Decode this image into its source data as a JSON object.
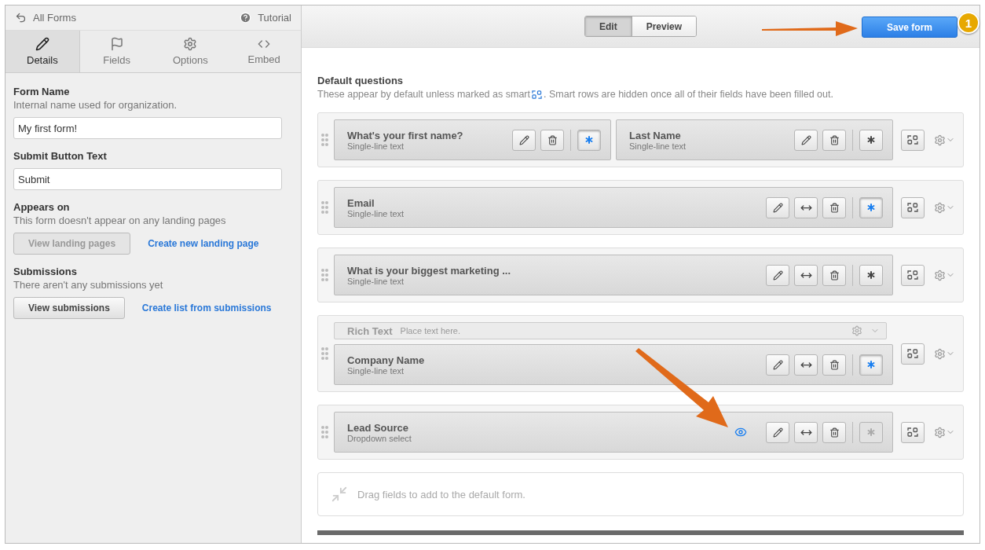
{
  "sidebar": {
    "back_link": "All Forms",
    "help_link": "Tutorial",
    "tabs": [
      {
        "label": "Details",
        "selected": true
      },
      {
        "label": "Fields",
        "selected": false
      },
      {
        "label": "Options",
        "selected": false
      },
      {
        "label": "Embed",
        "selected": false
      }
    ],
    "sections": [
      {
        "kind": "input",
        "title": "Form Name",
        "hint": "Internal name used for organization.",
        "value": "My first form!"
      },
      {
        "kind": "input",
        "title": "Submit Button Text",
        "value": "Submit"
      },
      {
        "kind": "actions",
        "title": "Appears on",
        "hint": "This form doesn't appear on any landing pages",
        "button": {
          "label": "View landing pages",
          "disabled": true
        },
        "link": "Create new landing page"
      },
      {
        "kind": "actions",
        "title": "Submissions",
        "hint": "There aren't any submissions yet",
        "button": {
          "label": "View submissions",
          "disabled": false
        },
        "link": "Create list from submissions"
      }
    ]
  },
  "toolbar": {
    "modes": [
      {
        "label": "Edit",
        "selected": true
      },
      {
        "label": "Preview",
        "selected": false
      }
    ],
    "save_button": "Save form",
    "badge": "1"
  },
  "questions": {
    "title": "Default questions",
    "description_before": "These appear by default unless marked as smart",
    "description_after": ". Smart rows are hidden once all of their fields have been filled out.",
    "rows": [
      {
        "fields": [
          {
            "label": "What's your first name?",
            "type": "Single-line text",
            "width_button": false,
            "visible_icon": false,
            "required": true,
            "required_disabled": false
          },
          {
            "label": "Last Name",
            "type": "Single-line text",
            "width_button": false,
            "visible_icon": false,
            "required": false,
            "required_disabled": false
          }
        ]
      },
      {
        "fields": [
          {
            "label": "Email",
            "type": "Single-line text",
            "width_button": true,
            "visible_icon": false,
            "required": true,
            "required_disabled": false
          }
        ]
      },
      {
        "fields": [
          {
            "label": "What is your biggest marketing ...",
            "type": "Single-line text",
            "width_button": true,
            "visible_icon": false,
            "required": false,
            "required_disabled": false
          }
        ]
      },
      {
        "rich_text": {
          "label": "Rich Text",
          "placeholder": "Place text here."
        },
        "fields": [
          {
            "label": "Company Name",
            "type": "Single-line text",
            "width_button": true,
            "visible_icon": false,
            "required": true,
            "required_disabled": false
          }
        ]
      },
      {
        "fields": [
          {
            "label": "Lead Source",
            "type": "Dropdown select",
            "width_button": true,
            "visible_icon": true,
            "required": false,
            "required_disabled": true
          }
        ]
      }
    ],
    "drop_zone": "Drag fields to add to the default form."
  }
}
